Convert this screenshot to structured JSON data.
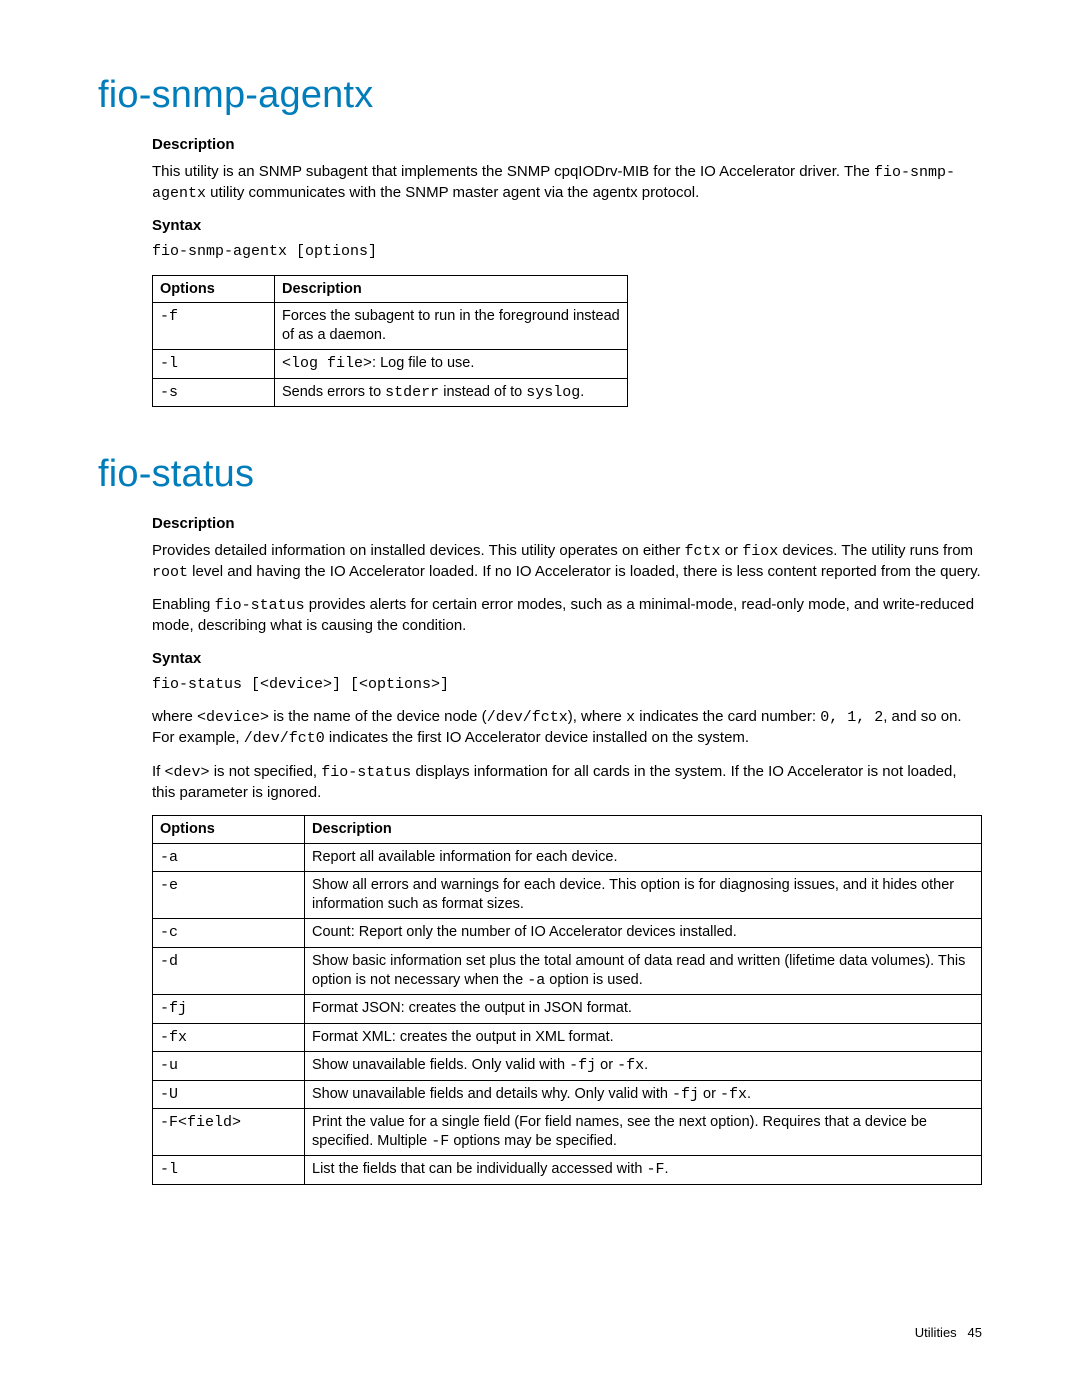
{
  "section1": {
    "title": "fio-snmp-agentx",
    "desc_heading": "Description",
    "desc_p1_a": "This utility is an SNMP subagent that implements the SNMP cpqIODrv-MIB for the IO Accelerator driver. The ",
    "desc_p1_code": "fio-snmp-agentx",
    "desc_p1_b": " utility communicates with the SNMP master agent via the agentx protocol.",
    "syntax_heading": "Syntax",
    "syntax_code": "fio-snmp-agentx [options]",
    "table": {
      "h_opt": "Options",
      "h_desc": "Description",
      "rows": [
        {
          "opt": "-f",
          "desc_a": "Forces the subagent to run in the foreground instead of as a daemon."
        },
        {
          "opt": "-l",
          "desc_code1": "<log file>",
          "desc_a": ": Log file to use."
        },
        {
          "opt": "-s",
          "desc_a": "Sends errors to ",
          "desc_code1": "stderr",
          "desc_b": " instead of to ",
          "desc_code2": "syslog",
          "desc_c": "."
        }
      ]
    }
  },
  "section2": {
    "title": "fio-status",
    "desc_heading": "Description",
    "desc_p1_a": "Provides detailed information on installed devices. This utility operates on either ",
    "desc_p1_code1": "fctx",
    "desc_p1_b": " or ",
    "desc_p1_code2": "fiox",
    "desc_p1_c": " devices. The utility runs from ",
    "desc_p1_code3": "root",
    "desc_p1_d": " level and having the IO Accelerator loaded. If no IO Accelerator is loaded, there is less content reported from the query.",
    "desc_p2_a": "Enabling ",
    "desc_p2_code1": "fio-status",
    "desc_p2_b": " provides alerts for certain error modes, such as a minimal-mode, read-only mode, and write-reduced mode, describing what is causing the condition.",
    "syntax_heading": "Syntax",
    "syntax_code": "fio-status [<device>] [<options>]",
    "where_p1_a": "where ",
    "where_p1_code1": "<device>",
    "where_p1_b": " is the name of the device node (",
    "where_p1_code2": "/dev/fctx",
    "where_p1_c": "), where ",
    "where_p1_code3": "x",
    "where_p1_d": " indicates the card number: ",
    "where_p1_code4": "0, 1, 2",
    "where_p1_e": ", and so on. For example, ",
    "where_p1_code5": "/dev/fct0",
    "where_p1_f": " indicates the first IO Accelerator device installed on the system.",
    "where_p2_a": "If ",
    "where_p2_code1": "<dev>",
    "where_p2_b": " is not specified, ",
    "where_p2_code2": "fio-status",
    "where_p2_c": " displays information for all cards in the system. If the IO Accelerator is not loaded, this parameter is ignored.",
    "table": {
      "h_opt": "Options",
      "h_desc": "Description",
      "rows": [
        {
          "opt": "-a",
          "desc_a": "Report all available information for each device."
        },
        {
          "opt": "-e",
          "desc_a": "Show all errors and warnings for each device. This option is for diagnosing issues, and it hides other information such as format sizes."
        },
        {
          "opt": "-c",
          "desc_a": "Count: Report only the number of IO Accelerator devices installed."
        },
        {
          "opt": "-d",
          "desc_a": "Show basic information set plus the total amount of data read and written (lifetime data volumes). This option is not necessary when the ",
          "desc_code1": "-a",
          "desc_b": " option is used."
        },
        {
          "opt": "-fj",
          "desc_a": "Format JSON: creates the output in JSON format."
        },
        {
          "opt": "-fx",
          "desc_a": "Format XML: creates the output in XML format."
        },
        {
          "opt": "-u",
          "desc_a": "Show unavailable fields. Only valid with ",
          "desc_code1": "-fj",
          "desc_b": " or ",
          "desc_code2": "-fx",
          "desc_c": "."
        },
        {
          "opt": "-U",
          "desc_a": "Show unavailable fields and details why. Only valid with ",
          "desc_code1": "-fj",
          "desc_b": " or ",
          "desc_code2": "-fx",
          "desc_c": "."
        },
        {
          "opt": "-F<field>",
          "desc_a": "Print the value for a single field (For field names, see the next option). Requires that a device be specified. Multiple ",
          "desc_code1": "-F",
          "desc_b": " options may be specified."
        },
        {
          "opt": "-l",
          "desc_a": "List the fields that can be individually accessed with ",
          "desc_code1": "-F",
          "desc_b": "."
        }
      ]
    }
  },
  "footer": {
    "label": "Utilities",
    "page": "45"
  }
}
